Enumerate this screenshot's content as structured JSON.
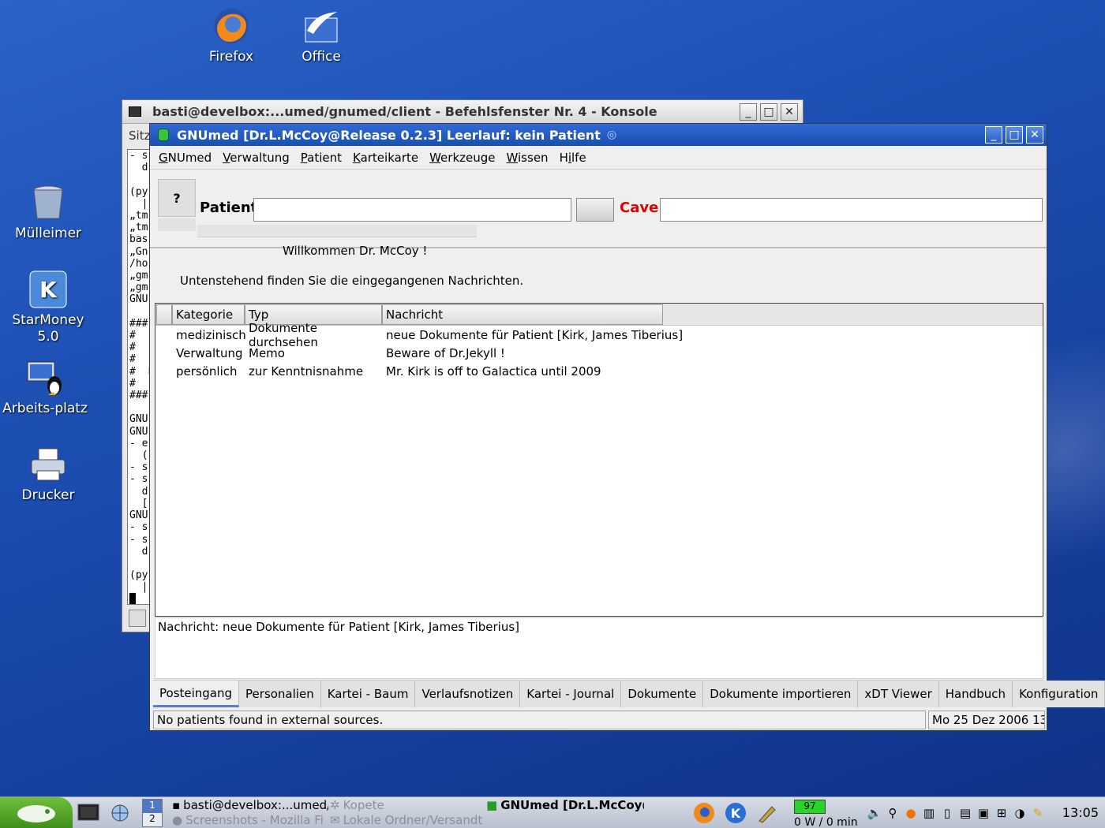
{
  "desktop": {
    "icons": [
      {
        "label": "Firefox"
      },
      {
        "label": "Office"
      },
      {
        "label": "Mülleimer"
      },
      {
        "label": "StarMoney 5.0"
      },
      {
        "label": "Arbeits-platz"
      },
      {
        "label": "Drucker"
      }
    ]
  },
  "konsole": {
    "title": "basti@develbox:...umed/gnumed/client - Befehlsfenster Nr. 4 - Konsole",
    "menu_fragment": "Sitz",
    "terminal_lines": "- s\n  d\n\n(py\n  ||\n„tm\n„tm\nbas\n„Gn\n/ho\n„gm\n„gm\nGNU\n\n###\n#\n#  1\n#\n#  P\n#\n###\n\nGNU\nGNU\n- e\n  (\n- s\n- s\n  d\n  [\nGNU\n- s\n- s\n  d\n\n(py\n  ||\n█"
  },
  "gnumed": {
    "title": "GNUmed [Dr.L.McCoy@Release 0.2.3] Leerlauf: kein Patient",
    "menu": [
      {
        "label": "GNUmed",
        "accel": "G"
      },
      {
        "label": "Verwaltung",
        "accel": "V"
      },
      {
        "label": "Patient",
        "accel": "P"
      },
      {
        "label": "Karteikarte",
        "accel": "K"
      },
      {
        "label": "Werkzeuge",
        "accel": "W"
      },
      {
        "label": "Wissen",
        "accel": "W"
      },
      {
        "label": "Hilfe",
        "accel": "i"
      }
    ],
    "toolbar": {
      "photo_placeholder": "?",
      "patient_label": "Patient",
      "patient_value": "",
      "cave_label": "Cave",
      "cave_value": ""
    },
    "welcome": "Willkommen Dr. McCoy !",
    "info": "Untenstehend finden Sie die eingegangenen Nachrichten.",
    "inbox": {
      "columns": [
        "Kategorie",
        "Typ",
        "Nachricht"
      ],
      "rows": [
        [
          "medizinisch",
          "Dokumente durchsehen",
          "neue Dokumente für Patient [Kirk, James Tiberius]"
        ],
        [
          "Verwaltung",
          "Memo",
          "Beware of Dr.Jekyll !"
        ],
        [
          "persönlich",
          "zur Kenntnisnahme",
          "Mr. Kirk is off to Galactica until 2009"
        ]
      ]
    },
    "preview": "Nachricht: neue Dokumente für Patient [Kirk, James Tiberius]",
    "tabs": [
      "Posteingang",
      "Personalien",
      "Kartei - Baum",
      "Verlaufsnotizen",
      "Kartei - Journal",
      "Dokumente",
      "Dokumente importieren",
      "xDT Viewer",
      "Handbuch",
      "Konfiguration"
    ],
    "active_tab": "Posteingang",
    "status_left": "No patients found in external sources.",
    "status_right": "Mo 25 Dez 2006 13:"
  },
  "taskbar": {
    "pager": {
      "desk1": "1",
      "desk2": "2"
    },
    "tasks": [
      {
        "label": "basti@develbox:...umed/c"
      },
      {
        "label": "Kopete"
      },
      {
        "label": "Screenshots - Mozilla Fi"
      },
      {
        "label": "Lokale Ordner/Versandte"
      },
      {
        "label": "GNUmed [Dr.L.McCoy@"
      }
    ],
    "battery_level": "97",
    "power_text": "0 W / 0 min",
    "clock": "13:05"
  },
  "colors": {
    "desktop_blue": "#1d4fb3",
    "cave_red": "#e00000",
    "title_blue": "#2f6bd6"
  }
}
